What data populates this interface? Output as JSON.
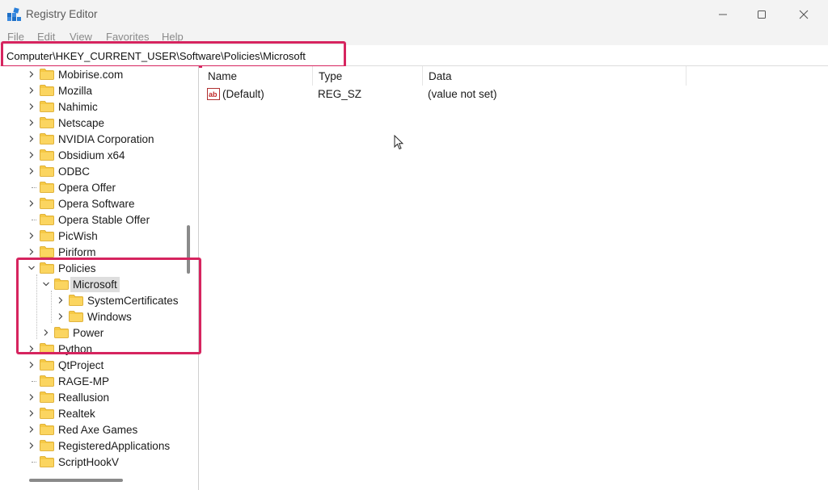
{
  "window": {
    "title": "Registry Editor"
  },
  "menu": {
    "items": [
      "File",
      "Edit",
      "View",
      "Favorites",
      "Help"
    ]
  },
  "address": {
    "path": "Computer\\HKEY_CURRENT_USER\\Software\\Policies\\Microsoft"
  },
  "tree": {
    "items": [
      {
        "label": "Mobirise.com",
        "expander": true
      },
      {
        "label": "Mozilla",
        "expander": true
      },
      {
        "label": "Nahimic",
        "expander": true
      },
      {
        "label": "Netscape",
        "expander": true
      },
      {
        "label": "NVIDIA Corporation",
        "expander": true
      },
      {
        "label": "Obsidium x64",
        "expander": true
      },
      {
        "label": "ODBC",
        "expander": true
      },
      {
        "label": "Opera Offer",
        "expander": false
      },
      {
        "label": "Opera Software",
        "expander": true
      },
      {
        "label": "Opera Stable Offer",
        "expander": false
      },
      {
        "label": "PicWish",
        "expander": true
      },
      {
        "label": "Piriform",
        "expander": true
      },
      {
        "label": "Policies",
        "expander": true,
        "expanded": true
      },
      {
        "label": "Microsoft",
        "expander": true,
        "expanded": true,
        "selected": true,
        "level": 1
      },
      {
        "label": "SystemCertificates",
        "expander": true,
        "level": 2
      },
      {
        "label": "Windows",
        "expander": true,
        "level": 2
      },
      {
        "label": "Power",
        "expander": true,
        "level": 1
      },
      {
        "label": "Python",
        "expander": true
      },
      {
        "label": "QtProject",
        "expander": true
      },
      {
        "label": "RAGE-MP",
        "expander": false
      },
      {
        "label": "Reallusion",
        "expander": true
      },
      {
        "label": "Realtek",
        "expander": true
      },
      {
        "label": "Red Axe Games",
        "expander": true
      },
      {
        "label": "RegisteredApplications",
        "expander": true
      },
      {
        "label": "ScriptHookV",
        "expander": false
      }
    ]
  },
  "list": {
    "columns": [
      "Name",
      "Type",
      "Data"
    ],
    "rows": [
      {
        "name": "(Default)",
        "type": "REG_SZ",
        "data": "(value not set)",
        "icon": "string-value-icon"
      }
    ]
  },
  "colors": {
    "highlight": "#d6245f",
    "folder": "#f6c945",
    "selection": "#dedede"
  }
}
